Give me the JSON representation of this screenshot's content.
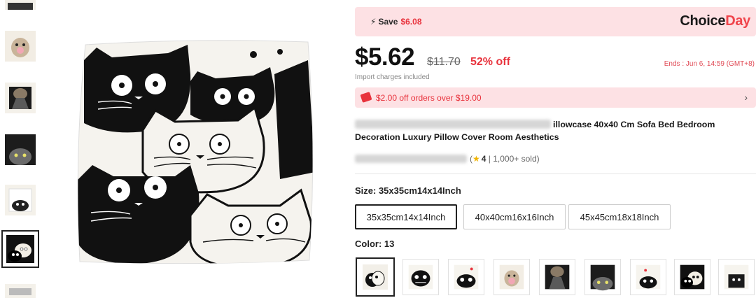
{
  "product": {
    "title_line1": "illowcase 40x40 Cm Sofa Bed Bedroom",
    "title_line2": "Decoration Luxury Pillow Cover Room Aesthetics",
    "rating_value": "4",
    "sold": "1,000+ sold",
    "main_image": "black-and-white-cats-pillow-image"
  },
  "choice_banner": {
    "save_label": "Save",
    "save_amount": "$6.08",
    "brand_part1": "Choice",
    "brand_part2": "Day",
    "bolt_icon": "lightning-bolt-icon"
  },
  "pricing": {
    "current_price": "$5.62",
    "original_price": "$11.70",
    "discount": "52% off",
    "ends": "Ends : Jun 6, 14:59 (GMT+8)",
    "import_note": "Import charges included"
  },
  "coupon": {
    "text": "$2.00 off orders over $19.00",
    "icon": "coupon-tag-icon",
    "chevron": "›"
  },
  "size": {
    "label": "Size: 35x35cm14x14Inch",
    "options": [
      "35x35cm14x14Inch",
      "40x40cm16x16Inch",
      "45x45cm18x18Inch"
    ],
    "selected_index": 0
  },
  "color": {
    "label": "Color: 13",
    "swatch_count": 9,
    "selected_index": 0
  },
  "colors": {
    "accent_red": "#e8323c",
    "banner_pink": "#fde1e4",
    "star": "#f0b400"
  }
}
